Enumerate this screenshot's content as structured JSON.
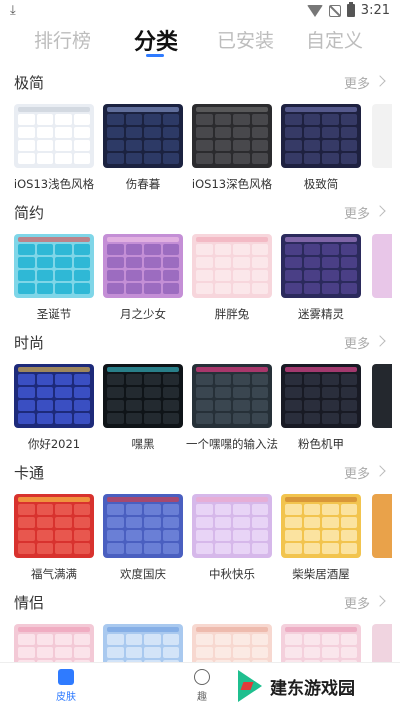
{
  "status_bar": {
    "time": "3:21",
    "download_glyph": "⤓"
  },
  "tabs": [
    {
      "label": "排行榜",
      "active": false
    },
    {
      "label": "分类",
      "active": true
    },
    {
      "label": "已安装",
      "active": false
    },
    {
      "label": "自定义",
      "active": false
    }
  ],
  "more_label": "更多",
  "sections": [
    {
      "title": "极简",
      "items": [
        {
          "name": "iOS13浅色风格",
          "bg": "#e9edf3",
          "key": "#ffffff",
          "bar": "#c5ccd6"
        },
        {
          "name": "伤春暮",
          "bg": "#1b2240",
          "key": "#2d3a66",
          "bar": "#8fa2d8"
        },
        {
          "name": "iOS13深色风格",
          "bg": "#2b2b2e",
          "key": "#48484c",
          "bar": "#777"
        },
        {
          "name": "极致简",
          "bg": "#1e2140",
          "key": "#363a66",
          "bar": "#7a7fbf"
        }
      ],
      "peek": "#f2f2f2"
    },
    {
      "title": "简约",
      "items": [
        {
          "name": "圣诞节",
          "bg": "#7fd6e8",
          "key": "#2fb8d6",
          "bar": "#e24b4b"
        },
        {
          "name": "月之少女",
          "bg": "#c48fd6",
          "key": "#9c6cc0",
          "bar": "#f5c7e8"
        },
        {
          "name": "胖胖兔",
          "bg": "#f7d6dc",
          "key": "#fbe7ea",
          "bar": "#f0a7b5"
        },
        {
          "name": "迷雾精灵",
          "bg": "#2b2a5c",
          "key": "#4a3f86",
          "bar": "#b58ed8"
        }
      ],
      "peek": "#e8c6e8"
    },
    {
      "title": "时尚",
      "items": [
        {
          "name": "你好2021",
          "bg": "#1d2a7a",
          "key": "#3a4fc2",
          "bar": "#f4c54a"
        },
        {
          "name": "嘿黑",
          "bg": "#0f1418",
          "key": "#232a30",
          "bar": "#3bc7d6"
        },
        {
          "name": "一个嘿嘿的输入法",
          "bg": "#263038",
          "key": "#3a4650",
          "bar": "#ff3c8e"
        },
        {
          "name": "粉色机甲",
          "bg": "#181a24",
          "key": "#2a2e3c",
          "bar": "#ff4fa0"
        }
      ],
      "peek": "#24282e"
    },
    {
      "title": "卡通",
      "items": [
        {
          "name": "福气满满",
          "bg": "#d8322e",
          "key": "#e8574e",
          "bar": "#ffd24a"
        },
        {
          "name": "欢度国庆",
          "bg": "#4a5fc0",
          "key": "#6a7fd6",
          "bar": "#e23a3a"
        },
        {
          "name": "中秋快乐",
          "bg": "#d6b8ea",
          "key": "#e8d4f6",
          "bar": "#f0a7c8"
        },
        {
          "name": "柴柴居酒屋",
          "bg": "#f2c44e",
          "key": "#fbe3a0",
          "bar": "#c87a2a"
        }
      ],
      "peek": "#e9a24a"
    },
    {
      "title": "情侣",
      "items": [
        {
          "name": "",
          "bg": "#f3c9d6",
          "key": "#fbe3ea",
          "bar": "#ef9bb4"
        },
        {
          "name": "",
          "bg": "#a9c9ef",
          "key": "#d3e4f8",
          "bar": "#6f9fe0"
        },
        {
          "name": "",
          "bg": "#f7d8d0",
          "key": "#fbeae4",
          "bar": "#e8a898"
        },
        {
          "name": "",
          "bg": "#f4d0dc",
          "key": "#fae6ec",
          "bar": "#e898b4"
        }
      ],
      "peek": "#f0d4e0"
    }
  ],
  "bottom_nav": [
    {
      "label": "皮肤",
      "active": true,
      "color": "#2f7bff"
    },
    {
      "label": "趣",
      "active": false,
      "color": "#666666"
    }
  ],
  "watermark": {
    "text": "建东游戏园"
  }
}
